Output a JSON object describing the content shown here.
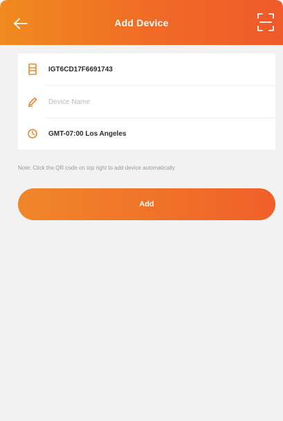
{
  "header": {
    "title": "Add Device",
    "back_icon": "arrow-left-icon",
    "scan_icon": "qr-scan-icon"
  },
  "form": {
    "device_id": "IGT6CD17F6691743",
    "device_name_placeholder": "Device Name",
    "timezone": "GMT-07:00 Los Angeles"
  },
  "hint": "Note: Click the QR code on top right to add device automatically",
  "add_button_label": "Add",
  "colors": {
    "accent": "#f06a26",
    "accent_light": "#f08a1f",
    "background": "#f2f2f2"
  }
}
